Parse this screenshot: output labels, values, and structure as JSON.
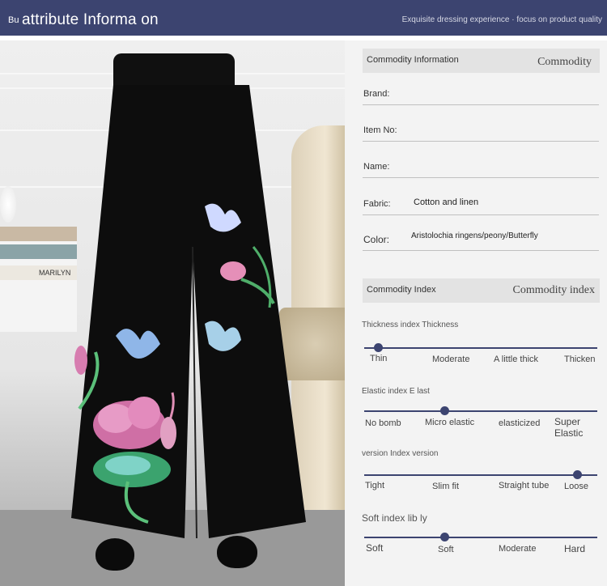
{
  "header": {
    "small_text": "Bu",
    "title": "attribute Informa on",
    "tagline": "Exquisite dressing experience · focus on product quality"
  },
  "commodity_info": {
    "label": "Commodity Information",
    "label_serif": "Commodity",
    "rows": [
      {
        "key": "Brand:",
        "value": ""
      },
      {
        "key": "Item No:",
        "value": ""
      },
      {
        "key": "Name:",
        "value": ""
      },
      {
        "key": "Fabric:",
        "value": "Cotton and linen"
      },
      {
        "key": "Color:",
        "value": "Aristolochia ringens/peony/Butterfly"
      }
    ]
  },
  "commodity_index": {
    "label": "Commodity Index",
    "label_serif": "Commodity index",
    "indices": [
      {
        "title": "Thickness index Thickness",
        "options": [
          "Thin",
          "Moderate",
          "A little thick",
          "Thicken"
        ],
        "selected": 0
      },
      {
        "title": "Elastic index E last",
        "options": [
          "No bomb",
          "Micro elastic",
          "elasticized",
          "Super Elastic"
        ],
        "selected": 1
      },
      {
        "title": "version Index version",
        "options": [
          "Tight",
          "Slim fit",
          "Straight tube",
          "Loose"
        ],
        "selected": 3
      },
      {
        "title": "Soft index lib ly",
        "options": [
          "Soft",
          "Soft",
          "Moderate",
          "Hard"
        ],
        "selected": 1
      }
    ]
  },
  "colors": {
    "accent": "#3c4470",
    "panel": "#f3f3f3",
    "section": "#e3e3e3"
  },
  "photo": {
    "subject": "black wide-leg pants with embroidered lotus and butterflies",
    "book_text": "MARILYN"
  }
}
